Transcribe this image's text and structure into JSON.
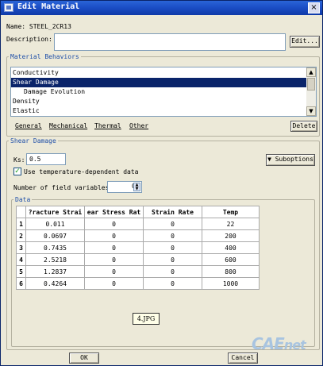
{
  "window": {
    "title": "Edit Material",
    "close_glyph": "×"
  },
  "name_line": "Name: STEEL_2CR13",
  "description_label": "Description:",
  "edit_button": "Edit...",
  "material_behaviors": {
    "legend": "Material Behaviors",
    "items": [
      "Conductivity",
      "Shear Damage",
      "Damage Evolution",
      "Density",
      "Elastic"
    ],
    "selected": "Shear Damage"
  },
  "menus": [
    "General",
    "Mechanical",
    "Thermal",
    "Other"
  ],
  "delete_button": "Delete",
  "shear_damage": {
    "legend": "Shear Damage",
    "ks_label": "Ks:",
    "ks_value": "0.5",
    "suboptions_button": "Suboptions",
    "temp_dependent_label": "Use temperature-dependent data",
    "temp_dependent_checked": true,
    "nfv_label": "Number of field variables:",
    "nfv_value": "0"
  },
  "data_table": {
    "legend": "Data",
    "headers": [
      "Fracture Strain",
      "Shear Stress Ratio",
      "Strain Rate",
      "Temp"
    ],
    "header_display": [
      "?racture Strai",
      "ear Stress Rat",
      "Strain Rate",
      "Temp"
    ],
    "rows": [
      {
        "n": "1",
        "cells": [
          "0.011",
          "0",
          "0",
          "22"
        ]
      },
      {
        "n": "2",
        "cells": [
          "0.0697",
          "0",
          "0",
          "200"
        ]
      },
      {
        "n": "3",
        "cells": [
          "0.7435",
          "0",
          "0",
          "400"
        ]
      },
      {
        "n": "4",
        "cells": [
          "2.5218",
          "0",
          "0",
          "600"
        ]
      },
      {
        "n": "5",
        "cells": [
          "1.2837",
          "0",
          "0",
          "800"
        ]
      },
      {
        "n": "6",
        "cells": [
          "0.4264",
          "0",
          "0",
          "1000"
        ]
      }
    ]
  },
  "image_label": "4.JPG",
  "ok_button": "OK",
  "cancel_button": "Cancel",
  "watermark": {
    "part1": "CAE",
    "part2": "net"
  },
  "colors": {
    "title_bar": "#1a4cc4",
    "selection": "#0a246a",
    "legend_text": "#2050a8",
    "window_bg": "#ece9d8"
  }
}
